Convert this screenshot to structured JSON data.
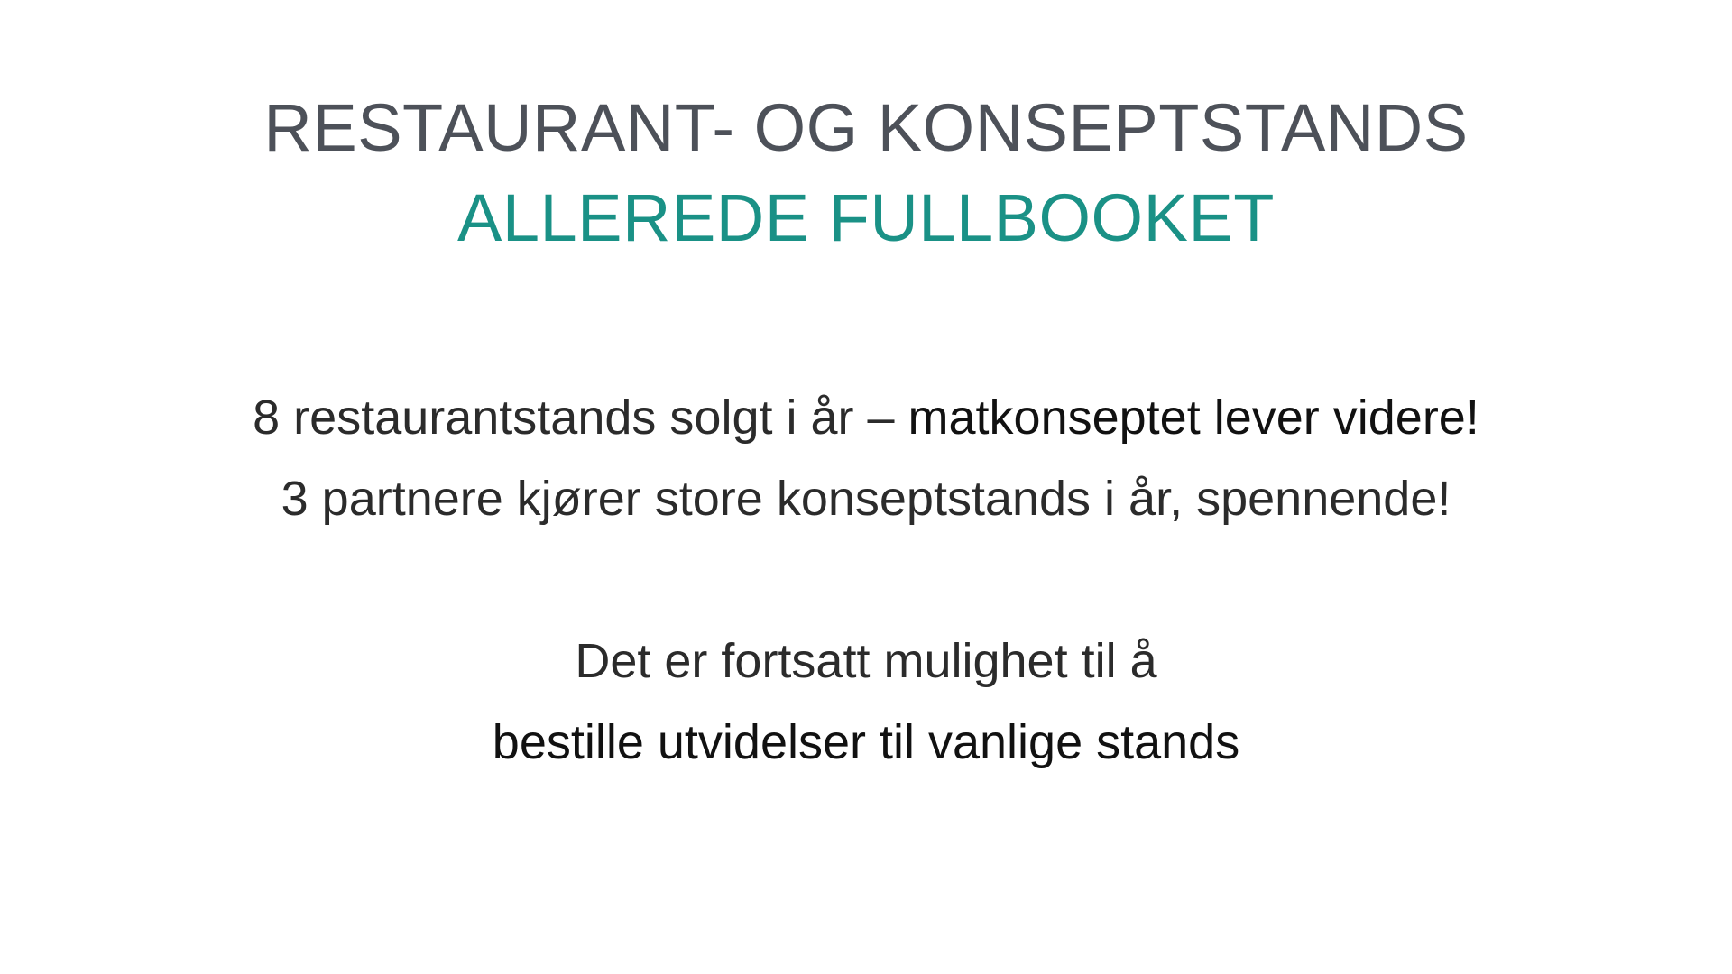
{
  "colors": {
    "dark": "#4d5159",
    "accent": "#1a9186",
    "body": "#2b2b2b",
    "strong": "#111111"
  },
  "title": {
    "line1": "RESTAURANT- OG KONSEPTSTANDS",
    "line2": "ALLEREDE FULLBOOKET"
  },
  "body": {
    "line1_regular": "8 restaurantstands solgt i år – ",
    "line1_bold": "matkonseptet lever videre!",
    "line2": "3 partnere kjører store konseptstands i år, spennende!",
    "line3": "Det er fortsatt mulighet til å",
    "line4_bold": "bestille utvidelser til vanlige stands"
  }
}
